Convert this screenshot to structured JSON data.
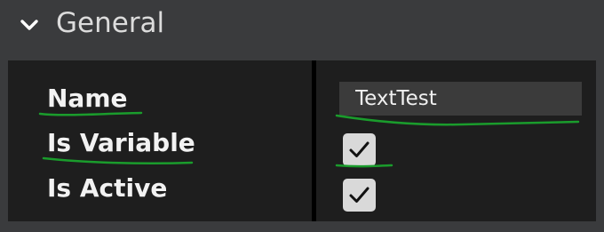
{
  "section": {
    "title": "General",
    "icon": "chevron-down-icon",
    "expanded": true
  },
  "properties": {
    "name": {
      "label": "Name",
      "value": "TextTest"
    },
    "is_variable": {
      "label": "Is Variable",
      "checked": true
    },
    "is_active": {
      "label": "Is Active",
      "checked": true
    }
  },
  "colors": {
    "background": "#3a3b3d",
    "panel": "#1e1e1e",
    "field": "#3b3b3b",
    "checkbox": "#d9d9d9",
    "annotation": "#1a9c2c"
  }
}
